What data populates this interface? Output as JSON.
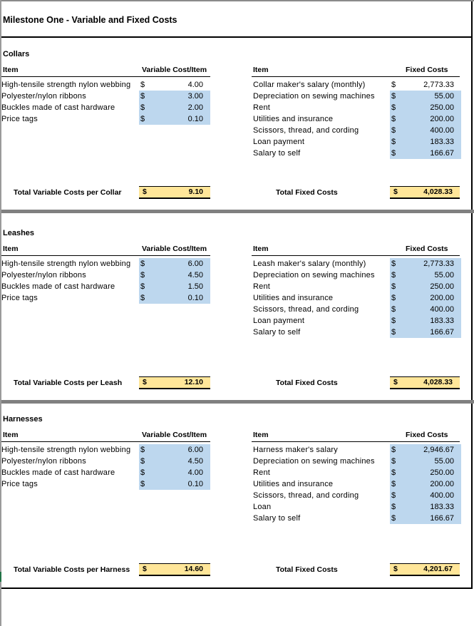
{
  "title": "Milestone One - Variable and Fixed Costs",
  "currency": "$",
  "colors": {
    "input_fill": "#bdd7ee",
    "total_fill": "#ffe699",
    "separator": "#808080"
  },
  "sections": [
    {
      "name": "Collars",
      "variable_header_item": "Item",
      "variable_header_cost": "Variable Cost/Item",
      "fixed_header_item": "Item",
      "fixed_header_cost": "Fixed Costs",
      "variable_items": [
        {
          "label": "High-tensile strength nylon webbing",
          "value": "4.00"
        },
        {
          "label": "Polyester/nylon ribbons",
          "value": "3.00"
        },
        {
          "label": "Buckles made of cast hardware",
          "value": "2.00"
        },
        {
          "label": "Price tags",
          "value": "0.10"
        }
      ],
      "fixed_items": [
        {
          "label": "Collar maker's salary (monthly)",
          "value": "2,773.33"
        },
        {
          "label": "Depreciation on sewing machines",
          "value": "55.00"
        },
        {
          "label": "Rent",
          "value": "250.00"
        },
        {
          "label": "Utilities and insurance",
          "value": "200.00"
        },
        {
          "label": "Scissors, thread, and cording",
          "value": "400.00"
        },
        {
          "label": "Loan payment",
          "value": "183.33"
        },
        {
          "label": "Salary to self",
          "value": "166.67"
        }
      ],
      "total_variable_label": "Total Variable Costs per Collar",
      "total_variable_value": "9.10",
      "total_fixed_label": "Total Fixed Costs",
      "total_fixed_value": "4,028.33"
    },
    {
      "name": "Leashes",
      "variable_header_item": "Item",
      "variable_header_cost": "Variable Cost/Item",
      "fixed_header_item": "Item",
      "fixed_header_cost": "Fixed Costs",
      "variable_items": [
        {
          "label": "High-tensile strength nylon webbing",
          "value": "6.00"
        },
        {
          "label": "Polyester/nylon ribbons",
          "value": "4.50"
        },
        {
          "label": "Buckles made of cast hardware",
          "value": "1.50"
        },
        {
          "label": "Price tags",
          "value": "0.10"
        }
      ],
      "fixed_items": [
        {
          "label": "Leash maker's salary (monthly)",
          "value": "2,773.33"
        },
        {
          "label": "Depreciation on sewing machines",
          "value": "55.00"
        },
        {
          "label": "Rent",
          "value": "250.00"
        },
        {
          "label": "Utilities and insurance",
          "value": "200.00"
        },
        {
          "label": "Scissors, thread, and cording",
          "value": "400.00"
        },
        {
          "label": "Loan payment",
          "value": "183.33"
        },
        {
          "label": "Salary to self",
          "value": "166.67"
        }
      ],
      "total_variable_label": "Total Variable Costs per Leash",
      "total_variable_value": "12.10",
      "total_fixed_label": "Total Fixed Costs",
      "total_fixed_value": "4,028.33"
    },
    {
      "name": "Harnesses",
      "variable_header_item": "Item",
      "variable_header_cost": "Variable Cost/Item",
      "fixed_header_item": "Item",
      "fixed_header_cost": "Fixed Costs",
      "variable_items": [
        {
          "label": "High-tensile strength nylon webbing",
          "value": "6.00"
        },
        {
          "label": "Polyester/nylon ribbons",
          "value": "4.50"
        },
        {
          "label": "Buckles made of cast hardware",
          "value": "4.00"
        },
        {
          "label": "Price tags",
          "value": "0.10"
        }
      ],
      "fixed_items": [
        {
          "label": "Harness maker's salary",
          "value": "2,946.67"
        },
        {
          "label": "Depreciation on sewing machines",
          "value": "55.00"
        },
        {
          "label": "Rent",
          "value": "250.00"
        },
        {
          "label": "Utilities and insurance",
          "value": "200.00"
        },
        {
          "label": "Scissors, thread, and cording",
          "value": "400.00"
        },
        {
          "label": "Loan",
          "value": "183.33"
        },
        {
          "label": "Salary to self",
          "value": "166.67"
        }
      ],
      "total_variable_label": "Total Variable Costs per Harness",
      "total_variable_value": "14.60",
      "total_fixed_label": "Total Fixed Costs",
      "total_fixed_value": "4,201.67"
    }
  ]
}
